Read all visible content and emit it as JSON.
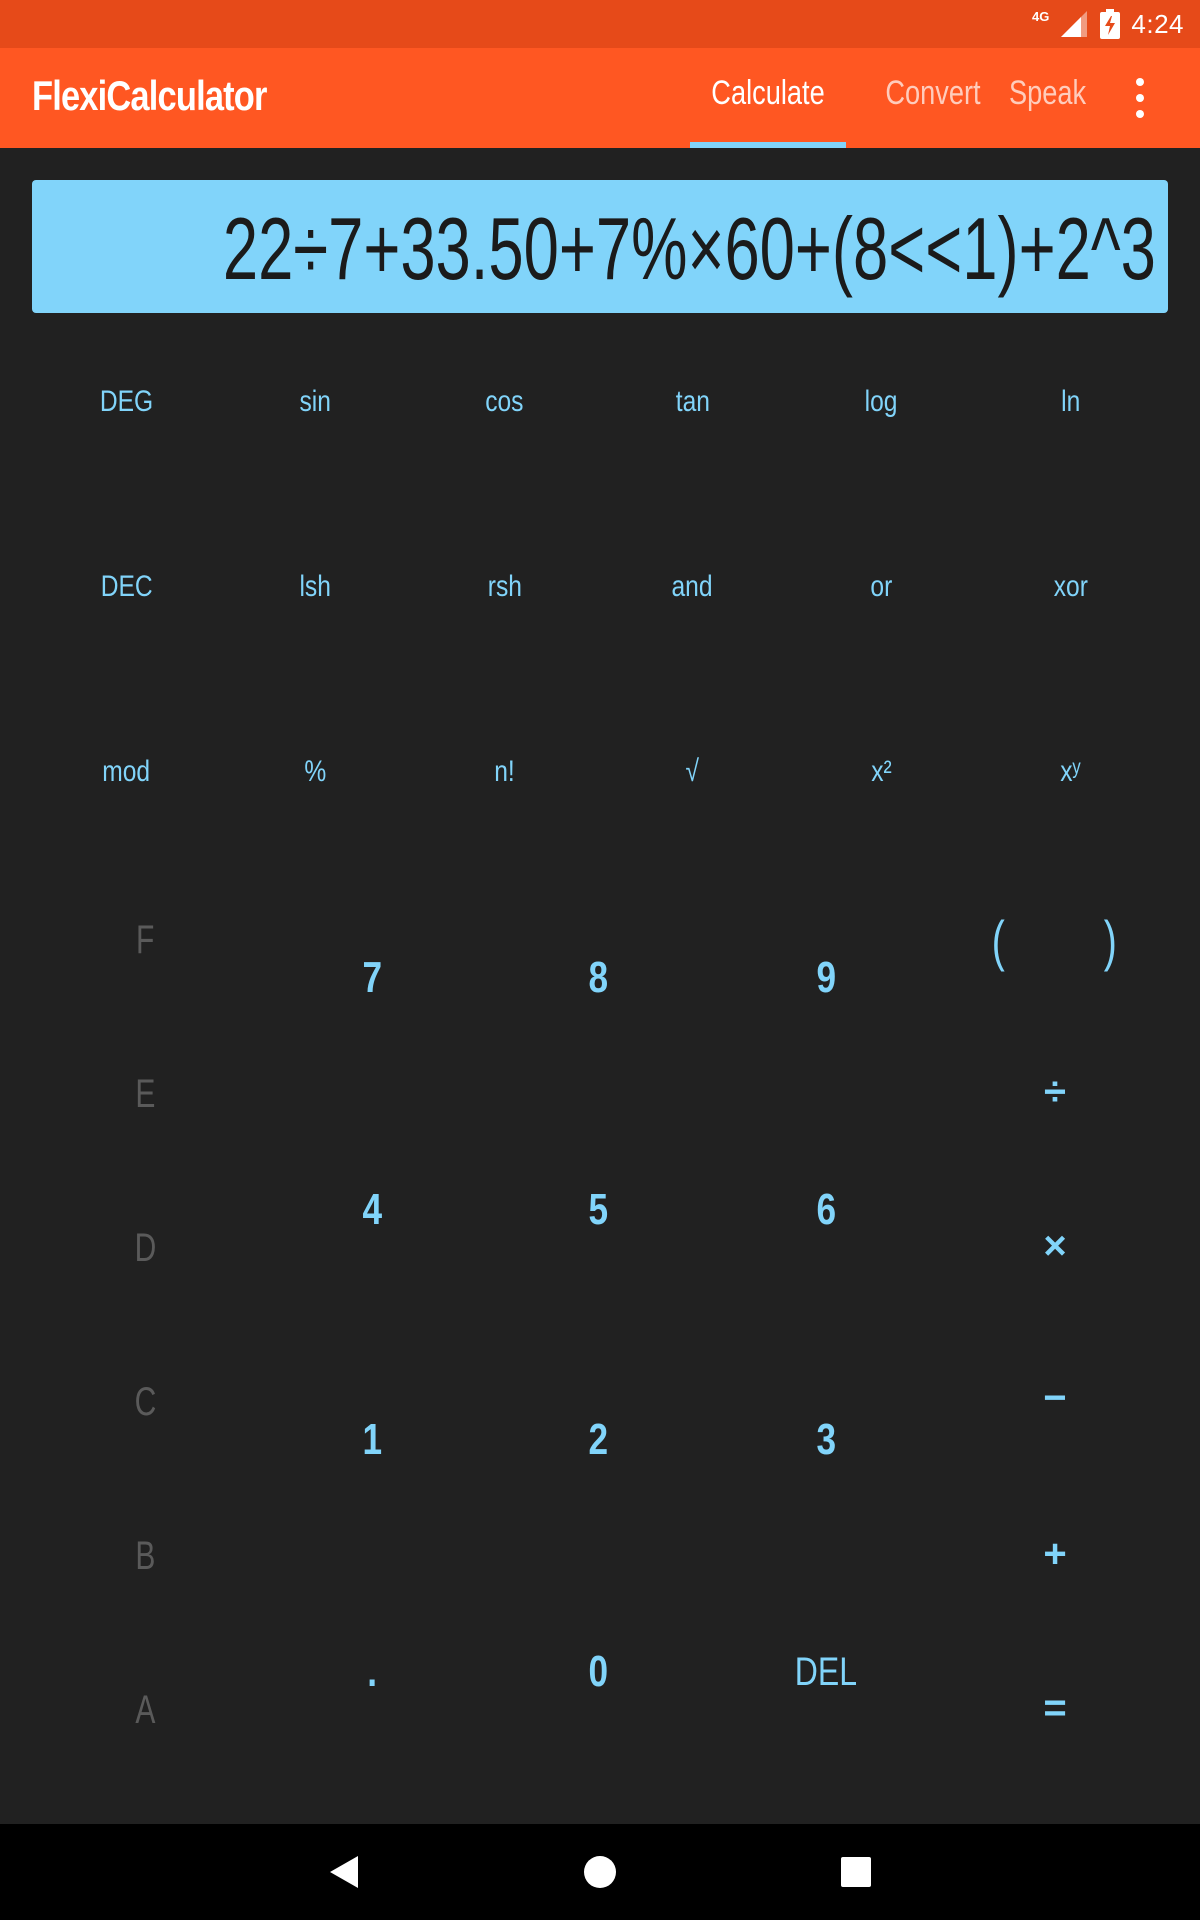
{
  "status_bar": {
    "network": "4G",
    "time": "4:24"
  },
  "app_bar": {
    "title": "FlexiCalculator",
    "tabs": [
      {
        "label": "Calculate",
        "active": true
      },
      {
        "label": "Convert",
        "active": false
      },
      {
        "label": "Speak",
        "active": false
      }
    ]
  },
  "display": {
    "expression": "22÷7+33.50+7%×60+(8<<1)+2^3"
  },
  "function_rows": [
    [
      "DEG",
      "sin",
      "cos",
      "tan",
      "log",
      "ln"
    ],
    [
      "DEC",
      "lsh",
      "rsh",
      "and",
      "or",
      "xor"
    ],
    [
      "mod",
      "%",
      "n!",
      "√",
      "x²",
      "xʸ"
    ]
  ],
  "hex_keys": [
    "F",
    "E",
    "D",
    "C",
    "B",
    "A"
  ],
  "numpad": {
    "row1": [
      "7",
      "8",
      "9"
    ],
    "row2": [
      "4",
      "5",
      "6"
    ],
    "row3": [
      "1",
      "2",
      "3"
    ],
    "row4": [
      ".",
      "0",
      "DEL"
    ]
  },
  "operators": {
    "open_paren": "(",
    "close_paren": ")",
    "divide": "÷",
    "multiply": "×",
    "minus": "−",
    "plus": "+",
    "equals": "="
  },
  "colors": {
    "status_bar": "#E64A19",
    "app_bar": "#FF5722",
    "display_bg": "#81D4FA",
    "key_text": "#81D4FA",
    "hex_key_text": "#5a5a5a",
    "background": "#212121"
  }
}
